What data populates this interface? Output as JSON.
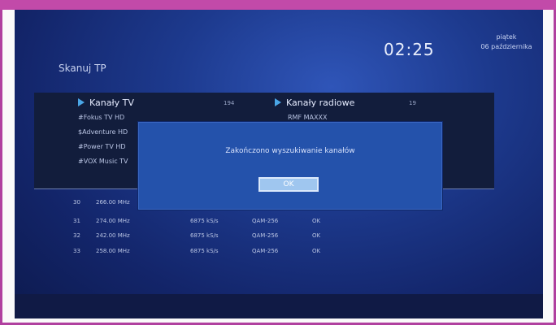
{
  "header": {
    "clock": "02:25",
    "day": "piątek",
    "date": "06 października"
  },
  "screen_title": "Skanuj TP",
  "tv": {
    "label": "Kanały TV",
    "count": "194",
    "channels": [
      "#Fokus TV HD",
      "$Adventure HD",
      "#Power TV HD",
      "#VOX Music TV"
    ]
  },
  "radio": {
    "label": "Kanały radiowe",
    "count": "19",
    "channels": [
      "RMF MAXXX"
    ]
  },
  "scan_rows": [
    {
      "num": "30",
      "freq": "266.00 MHz",
      "sr": "",
      "mod": "",
      "status": ""
    },
    {
      "num": "31",
      "freq": "274.00 MHz",
      "sr": "6875 kS/s",
      "mod": "QAM-256",
      "status": "OK"
    },
    {
      "num": "32",
      "freq": "242.00 MHz",
      "sr": "6875 kS/s",
      "mod": "QAM-256",
      "status": "OK"
    },
    {
      "num": "33",
      "freq": "258.00 MHz",
      "sr": "6875 kS/s",
      "mod": "QAM-256",
      "status": "OK"
    }
  ],
  "dialog": {
    "message": "Zakończono wyszukiwanie kanałów",
    "ok_label": "OK"
  },
  "colors": {
    "frame": "#b0409f",
    "screen_bg": "#1d3a8e",
    "dialog_bg": "#2452ab",
    "ok_button": "#9fc6ef",
    "arrow": "#4aa6e6"
  }
}
